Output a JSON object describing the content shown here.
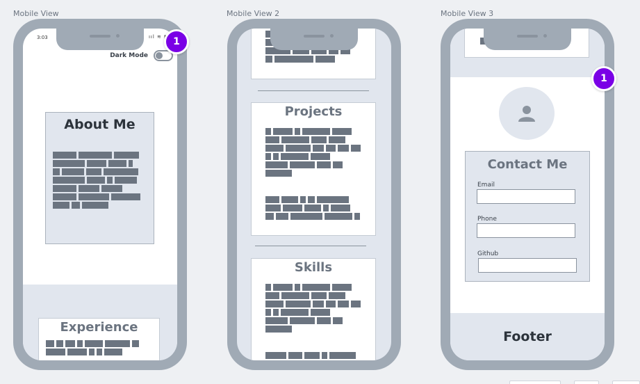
{
  "labels": {
    "view1": "Mobile View",
    "view2": "Mobile View 2",
    "view3": "Mobile View 3"
  },
  "view1": {
    "status_time": "3:03",
    "status_icons": "ııl ≋ ▮",
    "dark_mode_label": "Dark Mode",
    "dark_mode_on": false,
    "about_title": "About Me",
    "experience_title": "Experience",
    "badge": "1"
  },
  "view2": {
    "projects_title": "Projects",
    "skills_title": "Skills"
  },
  "view3": {
    "badge": "1",
    "contact_title": "Contact Me",
    "fields": [
      {
        "label": "Email",
        "value": ""
      },
      {
        "label": "Phone",
        "value": ""
      },
      {
        "label": "Github",
        "value": ""
      }
    ],
    "footer": "Footer"
  },
  "icons": {
    "avatar": "user-icon",
    "toggle": "toggle-switch-icon"
  },
  "colors": {
    "badge": "#7a00e6",
    "phone_frame": "#a0aab5",
    "card_fill": "#e1e6ee",
    "placeholder_text": "#6b7480",
    "heading": "#2c333b"
  }
}
